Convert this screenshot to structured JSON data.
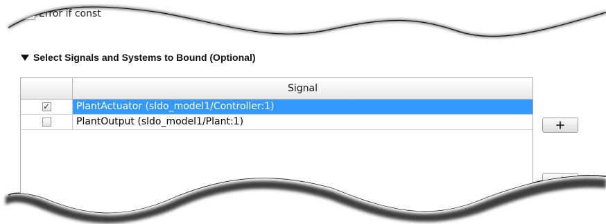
{
  "top_option": {
    "label": "Error if const"
  },
  "section": {
    "title": "Select Signals and Systems to Bound (Optional)"
  },
  "table": {
    "columns": [
      "",
      "Signal"
    ],
    "rows": [
      {
        "checked": true,
        "signal": "PlantActuator (sldo_model1/Controller:1)",
        "selected": true
      },
      {
        "checked": false,
        "signal": "PlantOutput (sldo_model1/Plant:1)",
        "selected": false
      }
    ]
  },
  "buttons": {
    "add_icon": "plus-icon",
    "edit_icon": "pencil-icon"
  },
  "colors": {
    "selection": "#3399ff",
    "paper_shadow": "#1a1a1a",
    "background": "#ffffff"
  }
}
